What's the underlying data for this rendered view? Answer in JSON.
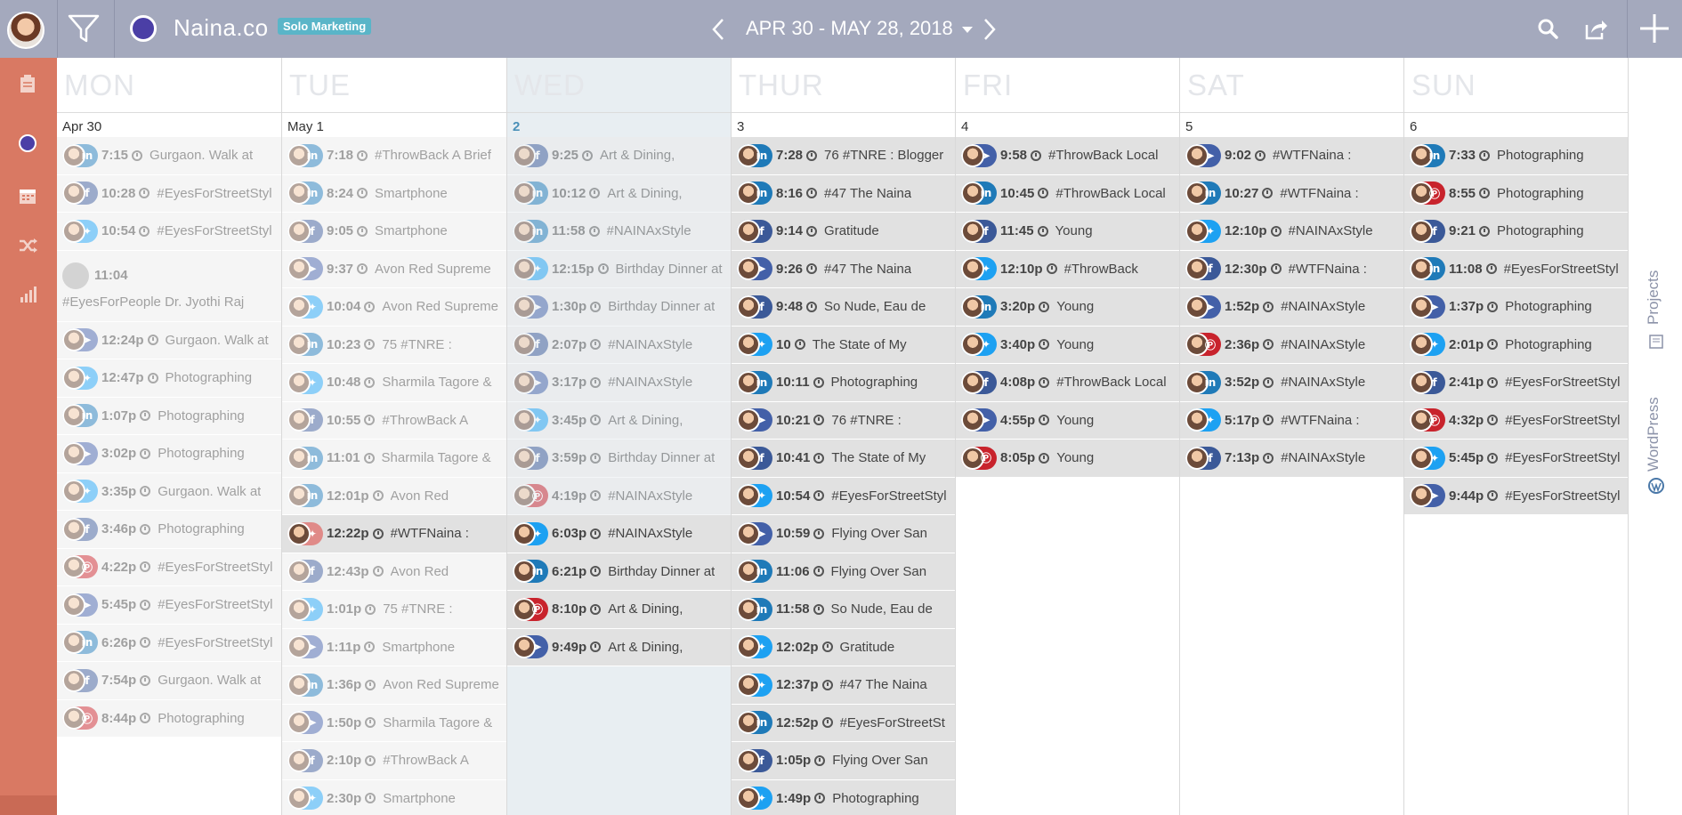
{
  "app": {
    "brand_name": "Naina.co",
    "badge": "Solo Marketing",
    "date_range": "APR 30 - MAY 28, 2018"
  },
  "rail": {
    "projects": "Projects",
    "wordpress": "WordPress"
  },
  "colors": {
    "linkedin": "#1f7ab8",
    "facebook": "#3b5998",
    "twitter": "#1da1f2",
    "pinterest": "#c8232c",
    "paperplane": "#4360a8",
    "sidebar": "#d97963",
    "topbar": "#a4a9bd"
  },
  "days": [
    {
      "name": "MON",
      "date": "Apr 30",
      "today": false,
      "posts": [
        {
          "net": "linkedin",
          "time": "7:15",
          "text": "Gurgaon. Walk at",
          "faded": true
        },
        {
          "net": "facebook",
          "time": "10:28",
          "text": "#EyesForStreetStyl",
          "faded": true
        },
        {
          "net": "twitter",
          "time": "10:54",
          "text": "#EyesForStreetStyl",
          "faded": true
        },
        {
          "net": "rss",
          "time": "11:04",
          "text": "#EyesForPeople Dr. Jyothi Raj",
          "faded": true,
          "tall": true
        },
        {
          "net": "paperplane",
          "time": "12:24p",
          "text": "Gurgaon. Walk at",
          "faded": true
        },
        {
          "net": "twitter",
          "time": "12:47p",
          "text": "Photographing",
          "faded": true
        },
        {
          "net": "linkedin",
          "time": "1:07p",
          "text": "Photographing",
          "faded": true
        },
        {
          "net": "paperplane",
          "time": "3:02p",
          "text": "Photographing",
          "faded": true
        },
        {
          "net": "twitter",
          "time": "3:35p",
          "text": "Gurgaon. Walk at",
          "faded": true
        },
        {
          "net": "facebook",
          "time": "3:46p",
          "text": "Photographing",
          "faded": true
        },
        {
          "net": "pinterest",
          "time": "4:22p",
          "text": "#EyesForStreetStyl",
          "faded": true
        },
        {
          "net": "paperplane",
          "time": "5:45p",
          "text": "#EyesForStreetStyl",
          "faded": true
        },
        {
          "net": "linkedin",
          "time": "6:26p",
          "text": "#EyesForStreetStyl",
          "faded": true
        },
        {
          "net": "facebook",
          "time": "7:54p",
          "text": "Gurgaon. Walk at",
          "faded": true
        },
        {
          "net": "pinterest",
          "time": "8:44p",
          "text": "Photographing",
          "faded": true
        }
      ]
    },
    {
      "name": "TUE",
      "date": "May 1",
      "today": false,
      "posts": [
        {
          "net": "linkedin",
          "time": "7:18",
          "text": "#ThrowBack A Brief",
          "faded": true
        },
        {
          "net": "linkedin",
          "time": "8:24",
          "text": "Smartphone",
          "faded": true
        },
        {
          "net": "facebook",
          "time": "9:05",
          "text": "Smartphone",
          "faded": true
        },
        {
          "net": "paperplane",
          "time": "9:37",
          "text": "Avon Red Supreme",
          "faded": true
        },
        {
          "net": "twitter",
          "time": "10:04",
          "text": "Avon Red Supreme",
          "faded": true
        },
        {
          "net": "linkedin",
          "time": "10:23",
          "text": "75 #TNRE :",
          "faded": true
        },
        {
          "net": "twitter",
          "time": "10:48",
          "text": "Sharmila Tagore &",
          "faded": true
        },
        {
          "net": "facebook",
          "time": "10:55",
          "text": "#ThrowBack A",
          "faded": true
        },
        {
          "net": "linkedin",
          "time": "11:01",
          "text": "Sharmila Tagore &",
          "faded": true
        },
        {
          "net": "linkedin",
          "time": "12:01p",
          "text": "Avon Red",
          "faded": true
        },
        {
          "net": "twitter",
          "time": "12:22p",
          "text": "#WTFNaina :",
          "faded": false,
          "highlight": true
        },
        {
          "net": "facebook",
          "time": "12:43p",
          "text": "Avon Red",
          "faded": true
        },
        {
          "net": "twitter",
          "time": "1:01p",
          "text": "75 #TNRE :",
          "faded": true
        },
        {
          "net": "paperplane",
          "time": "1:11p",
          "text": "Smartphone",
          "faded": true
        },
        {
          "net": "linkedin",
          "time": "1:36p",
          "text": "Avon Red Supreme",
          "faded": true
        },
        {
          "net": "paperplane",
          "time": "1:50p",
          "text": "Sharmila Tagore &",
          "faded": true
        },
        {
          "net": "facebook",
          "time": "2:10p",
          "text": "#ThrowBack A",
          "faded": true
        },
        {
          "net": "twitter",
          "time": "2:30p",
          "text": "Smartphone",
          "faded": true
        }
      ]
    },
    {
      "name": "WED",
      "date": "2",
      "today": true,
      "posts": [
        {
          "net": "facebook",
          "time": "9:25",
          "text": "Art & Dining,",
          "faded": true
        },
        {
          "net": "linkedin",
          "time": "10:12",
          "text": "Art & Dining,",
          "faded": true
        },
        {
          "net": "linkedin",
          "time": "11:58",
          "text": "#NAINAxStyle",
          "faded": true
        },
        {
          "net": "twitter",
          "time": "12:15p",
          "text": "Birthday Dinner at",
          "faded": true
        },
        {
          "net": "paperplane",
          "time": "1:30p",
          "text": "Birthday Dinner at",
          "faded": true
        },
        {
          "net": "facebook",
          "time": "2:07p",
          "text": "#NAINAxStyle",
          "faded": true
        },
        {
          "net": "paperplane",
          "time": "3:17p",
          "text": "#NAINAxStyle",
          "faded": true
        },
        {
          "net": "twitter",
          "time": "3:45p",
          "text": "Art & Dining,",
          "faded": true
        },
        {
          "net": "facebook",
          "time": "3:59p",
          "text": "Birthday Dinner at",
          "faded": true
        },
        {
          "net": "pinterest",
          "time": "4:19p",
          "text": "#NAINAxStyle",
          "faded": true
        },
        {
          "net": "twitter",
          "time": "6:03p",
          "text": "#NAINAxStyle",
          "faded": false
        },
        {
          "net": "linkedin",
          "time": "6:21p",
          "text": "Birthday Dinner at",
          "faded": false
        },
        {
          "net": "pinterest",
          "time": "8:10p",
          "text": "Art & Dining,",
          "faded": false
        },
        {
          "net": "paperplane",
          "time": "9:49p",
          "text": "Art & Dining,",
          "faded": false
        }
      ]
    },
    {
      "name": "THUR",
      "date": "3",
      "today": false,
      "posts": [
        {
          "net": "linkedin",
          "time": "7:28",
          "text": "76 #TNRE : Blogger",
          "faded": false
        },
        {
          "net": "linkedin",
          "time": "8:16",
          "text": "#47 The Naina",
          "faded": false
        },
        {
          "net": "facebook",
          "time": "9:14",
          "text": "Gratitude",
          "faded": false
        },
        {
          "net": "paperplane",
          "time": "9:26",
          "text": "#47 The Naina",
          "faded": false
        },
        {
          "net": "facebook",
          "time": "9:48",
          "text": "So Nude, Eau de",
          "faded": false
        },
        {
          "net": "twitter",
          "time": "10",
          "text": "The State of My",
          "faded": false
        },
        {
          "net": "linkedin",
          "time": "10:11",
          "text": "Photographing",
          "faded": false
        },
        {
          "net": "paperplane",
          "time": "10:21",
          "text": "76 #TNRE :",
          "faded": false
        },
        {
          "net": "facebook",
          "time": "10:41",
          "text": "The State of My",
          "faded": false
        },
        {
          "net": "twitter",
          "time": "10:54",
          "text": "#EyesForStreetStyl",
          "faded": false
        },
        {
          "net": "paperplane",
          "time": "10:59",
          "text": "Flying Over San",
          "faded": false
        },
        {
          "net": "linkedin",
          "time": "11:06",
          "text": "Flying Over San",
          "faded": false
        },
        {
          "net": "linkedin",
          "time": "11:58",
          "text": "So Nude, Eau de",
          "faded": false
        },
        {
          "net": "twitter",
          "time": "12:02p",
          "text": "Gratitude",
          "faded": false
        },
        {
          "net": "twitter",
          "time": "12:37p",
          "text": "#47 The Naina",
          "faded": false
        },
        {
          "net": "linkedin",
          "time": "12:52p",
          "text": "#EyesForStreetSt",
          "faded": false
        },
        {
          "net": "facebook",
          "time": "1:05p",
          "text": "Flying Over San",
          "faded": false
        },
        {
          "net": "twitter",
          "time": "1:49p",
          "text": "Photographing",
          "faded": false
        }
      ]
    },
    {
      "name": "FRI",
      "date": "4",
      "today": false,
      "posts": [
        {
          "net": "paperplane",
          "time": "9:58",
          "text": "#ThrowBack Local",
          "faded": false
        },
        {
          "net": "linkedin",
          "time": "10:45",
          "text": "#ThrowBack Local",
          "faded": false
        },
        {
          "net": "facebook",
          "time": "11:45",
          "text": "Young",
          "faded": false
        },
        {
          "net": "twitter",
          "time": "12:10p",
          "text": "#ThrowBack",
          "faded": false
        },
        {
          "net": "linkedin",
          "time": "3:20p",
          "text": "Young",
          "faded": false
        },
        {
          "net": "twitter",
          "time": "3:40p",
          "text": "Young",
          "faded": false
        },
        {
          "net": "facebook",
          "time": "4:08p",
          "text": "#ThrowBack Local",
          "faded": false
        },
        {
          "net": "paperplane",
          "time": "4:55p",
          "text": "Young",
          "faded": false
        },
        {
          "net": "pinterest",
          "time": "8:05p",
          "text": "Young",
          "faded": false
        }
      ]
    },
    {
      "name": "SAT",
      "date": "5",
      "today": false,
      "posts": [
        {
          "net": "paperplane",
          "time": "9:02",
          "text": "#WTFNaina :",
          "faded": false
        },
        {
          "net": "linkedin",
          "time": "10:27",
          "text": "#WTFNaina :",
          "faded": false
        },
        {
          "net": "twitter",
          "time": "12:10p",
          "text": "#NAINAxStyle",
          "faded": false
        },
        {
          "net": "facebook",
          "time": "12:30p",
          "text": "#WTFNaina :",
          "faded": false
        },
        {
          "net": "paperplane",
          "time": "1:52p",
          "text": "#NAINAxStyle",
          "faded": false
        },
        {
          "net": "pinterest",
          "time": "2:36p",
          "text": "#NAINAxStyle",
          "faded": false
        },
        {
          "net": "linkedin",
          "time": "3:52p",
          "text": "#NAINAxStyle",
          "faded": false
        },
        {
          "net": "twitter",
          "time": "5:17p",
          "text": "#WTFNaina :",
          "faded": false
        },
        {
          "net": "facebook",
          "time": "7:13p",
          "text": "#NAINAxStyle",
          "faded": false
        }
      ]
    },
    {
      "name": "SUN",
      "date": "6",
      "today": false,
      "posts": [
        {
          "net": "linkedin",
          "time": "7:33",
          "text": "Photographing",
          "faded": false
        },
        {
          "net": "pinterest",
          "time": "8:55",
          "text": "Photographing",
          "faded": false
        },
        {
          "net": "facebook",
          "time": "9:21",
          "text": "Photographing",
          "faded": false
        },
        {
          "net": "linkedin",
          "time": "11:08",
          "text": "#EyesForStreetStyl",
          "faded": false
        },
        {
          "net": "paperplane",
          "time": "1:37p",
          "text": "Photographing",
          "faded": false
        },
        {
          "net": "twitter",
          "time": "2:01p",
          "text": "Photographing",
          "faded": false
        },
        {
          "net": "facebook",
          "time": "2:41p",
          "text": "#EyesForStreetStyl",
          "faded": false
        },
        {
          "net": "pinterest",
          "time": "4:32p",
          "text": "#EyesForStreetStyl",
          "faded": false
        },
        {
          "net": "twitter",
          "time": "5:45p",
          "text": "#EyesForStreetStyl",
          "faded": false
        },
        {
          "net": "paperplane",
          "time": "9:44p",
          "text": "#EyesForStreetStyl",
          "faded": false
        }
      ]
    }
  ]
}
